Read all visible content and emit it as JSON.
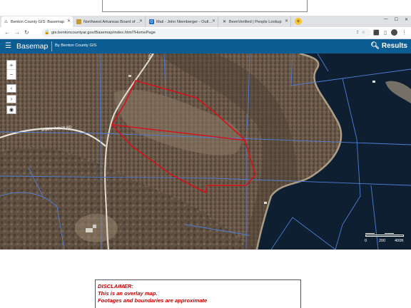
{
  "browser": {
    "tabs": [
      {
        "label": "Benton County GIS: Basemap",
        "active": true
      },
      {
        "label": "Northwest Arkansas Board of Re..."
      },
      {
        "label": "Mail - John Niemberger - Outlook"
      },
      {
        "label": "BeenVerified | People Lookup"
      }
    ],
    "new_tab_glyph": "+",
    "url": "gis.bentoncountyar.gov/Basemap/index.html?HomePage"
  },
  "app": {
    "title": "Basemap",
    "subtitle": "By Benton County GIS",
    "results_label": "Results",
    "header_color": "#0b5d94"
  },
  "map": {
    "road_label": "SNAKE RIDGE RD",
    "road_label_2": "VER",
    "parcel_line_color": "#4f7fd6",
    "highlight_color": "#d6111c",
    "water_color": "#0e1f32",
    "zoom_in_glyph": "+",
    "zoom_out_glyph": "−",
    "nav_glyphs": [
      "‹",
      "›",
      "◉"
    ],
    "scale_labels": [
      "0",
      "200",
      "400ft"
    ]
  },
  "disclaimer": {
    "heading": "DISCLAIMER:",
    "line1": "This is an overlay map.",
    "line2": "Footages and boundaries are approximate"
  }
}
